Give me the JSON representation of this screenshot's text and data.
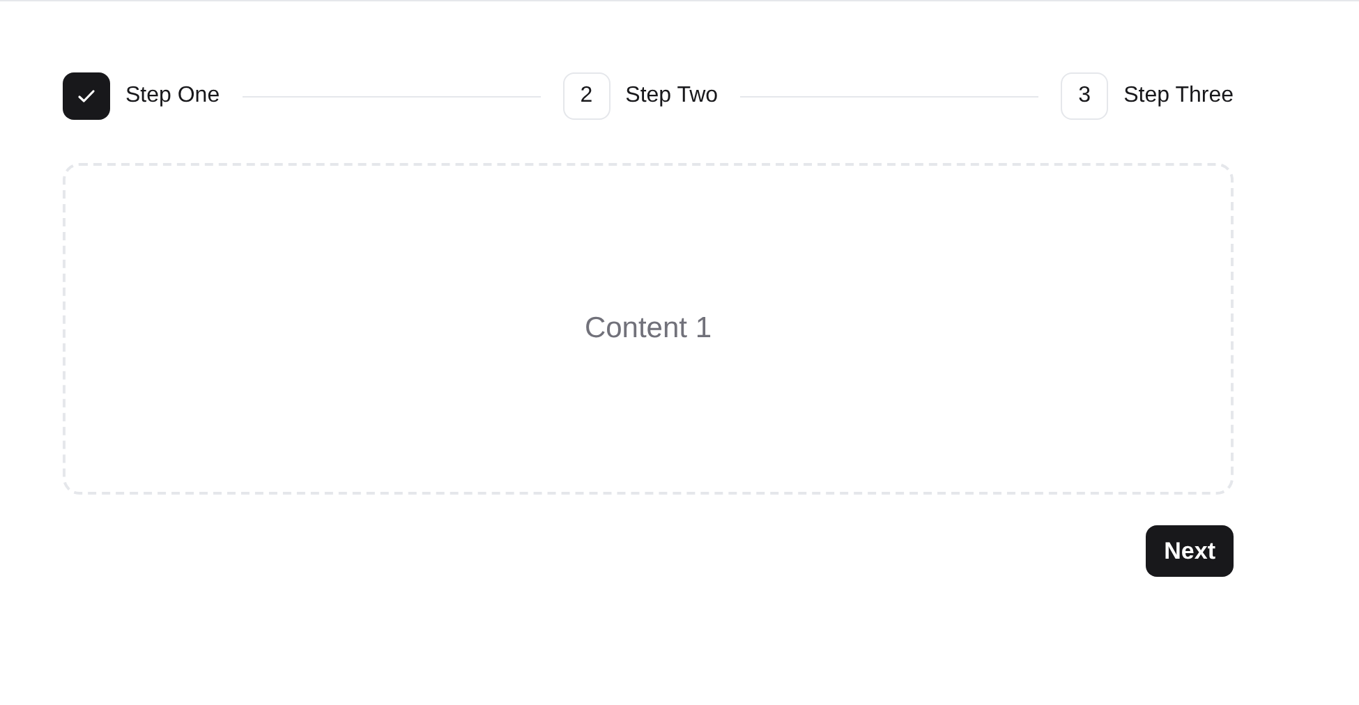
{
  "steps": [
    {
      "label": "Step One",
      "completed": true
    },
    {
      "label": "Step Two",
      "completed": false,
      "number": "2"
    },
    {
      "label": "Step Three",
      "completed": false,
      "number": "3"
    }
  ],
  "content": {
    "text": "Content 1"
  },
  "buttons": {
    "next": "Next"
  }
}
